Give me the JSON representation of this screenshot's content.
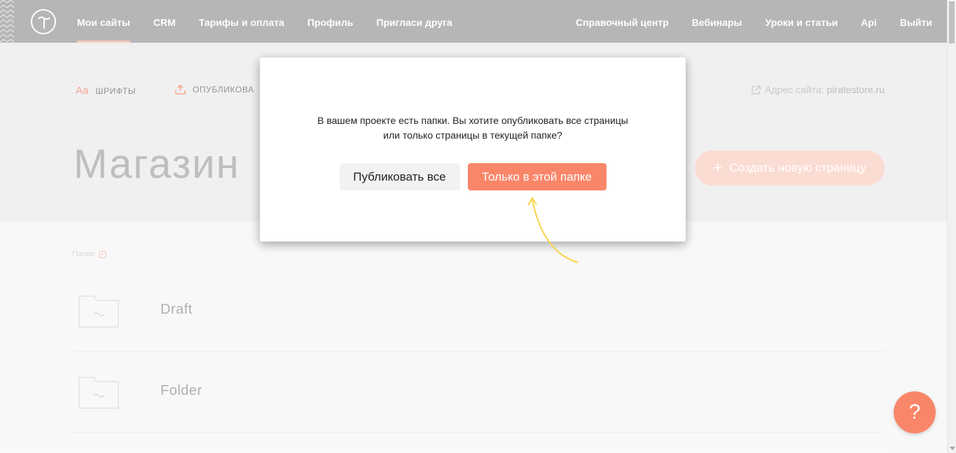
{
  "nav": {
    "left": [
      "Мои сайты",
      "CRM",
      "Тарифы и оплата",
      "Профиль",
      "Пригласи друга"
    ],
    "right": [
      "Справочный центр",
      "Вебинары",
      "Уроки и статьи",
      "Api",
      "Выйти"
    ]
  },
  "toolbar": {
    "fonts_icon_text": "Aa",
    "fonts_label": "ШРИФТЫ",
    "publish_label": "ОПУБЛИКОВА"
  },
  "site": {
    "address_label": "Адрес сайта:",
    "domain": "piratestore.ru"
  },
  "page": {
    "title": "Магазин",
    "create_button": "Создать новую страницу",
    "folders_label": "Папки:"
  },
  "folders": [
    {
      "name": "Draft"
    },
    {
      "name": "Folder"
    }
  ],
  "modal": {
    "line1": "В вашем проекте есть папки. Вы хотите опубликовать все страницы",
    "line2": "или только страницы в текущей папке?",
    "publish_all": "Публиковать все",
    "publish_folder": "Только в этой папке"
  },
  "help": {
    "label": "?"
  },
  "colors": {
    "accent": "#fa8669",
    "topbar": "#b0b0b0",
    "arrow": "#f9d44a"
  }
}
